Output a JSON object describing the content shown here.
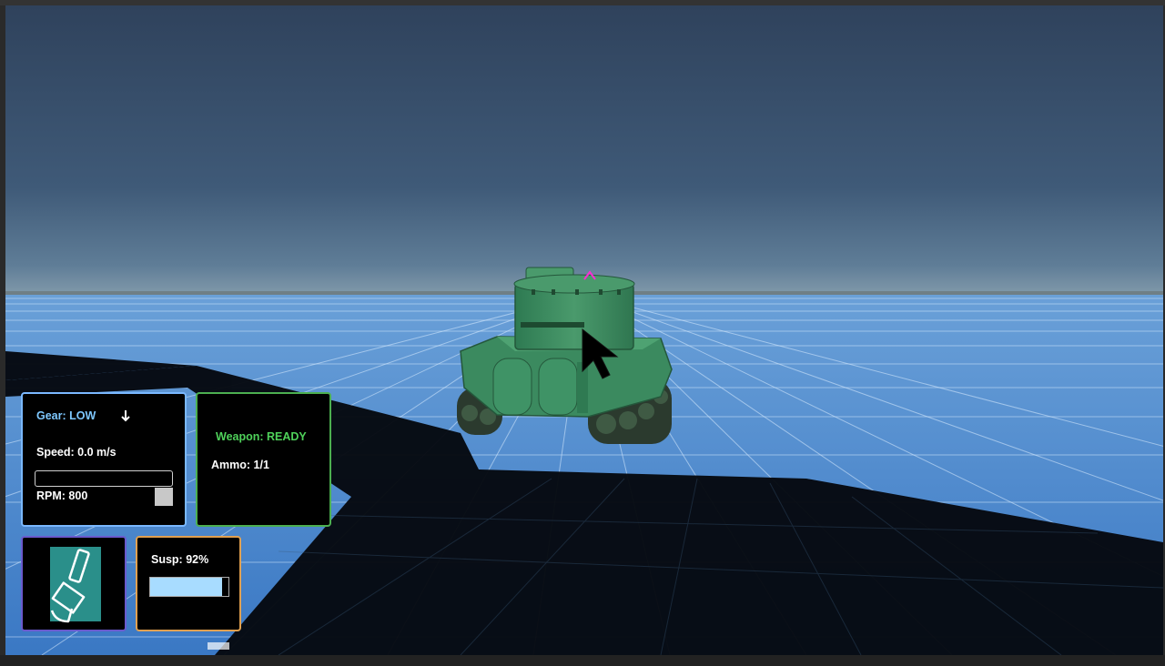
{
  "hud": {
    "gear": {
      "label": "Gear: LOW",
      "shift_icon": "arrow-down-icon"
    },
    "speed": {
      "label": "Speed: 0.0 m/s"
    },
    "throttle": {
      "level": 0
    },
    "rpm": {
      "label": "RPM: 800"
    },
    "weapon": {
      "status": "Weapon: READY",
      "ammo": "Ammo: 1/1"
    },
    "paint": {
      "icon": "paint-brush-icon"
    },
    "suspension": {
      "label": "Susp: 92%",
      "level": 0.92
    }
  },
  "colors": {
    "gear_text": "#7ec8ff",
    "weapon_text": "#4fd15a",
    "drive_panel_border": "#7ab8ff",
    "weapon_panel_border": "#4caf50",
    "paint_panel_border": "#6a5acd",
    "susp_panel_border": "#e0a050",
    "susp_fill": "#a8dcff",
    "tank_green": "#3a8a5e",
    "crosshair": "#ff2ad4"
  }
}
